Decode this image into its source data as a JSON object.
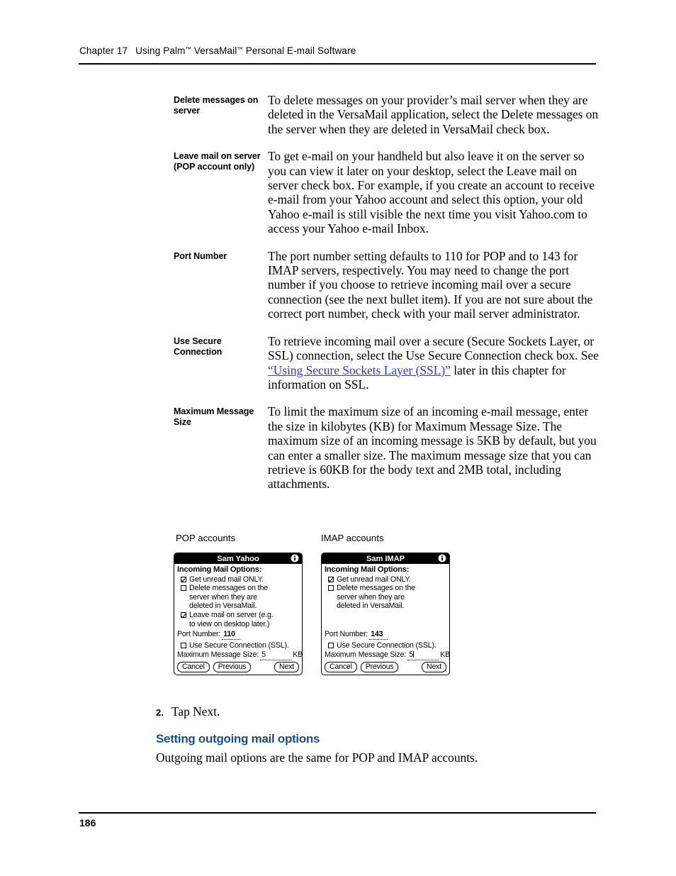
{
  "header": {
    "chapter": "Chapter 17",
    "title_part1": "Using Palm",
    "tm1": "™",
    "title_part2": " VersaMail",
    "tm2": "™",
    "title_part3": " Personal E-mail Software"
  },
  "definitions": [
    {
      "term": "Delete messages on server",
      "description": "To delete messages on your provider’s mail server when they are deleted in the VersaMail application, select the Delete messages on the server when they are deleted in VersaMail check box."
    },
    {
      "term": "Leave mail on server (POP account only)",
      "description": "To get e-mail on your handheld but also leave it on the server so you can view it later on your desktop, select the Leave mail on server check box. For example, if you create an account to receive e-mail from your Yahoo account and select this option, your old Yahoo e-mail is still visible the next time you visit Yahoo.com to access your Yahoo e-mail Inbox."
    },
    {
      "term": "Port Number",
      "description": "The port number setting defaults to 110 for POP and to 143 for IMAP servers, respectively. You may need to change the port number if you choose to retrieve incoming mail over a secure connection (see the next bullet item). If you are not sure about the correct port number, check with your mail server administrator."
    },
    {
      "term": "Use Secure Connection",
      "desc_before": "To retrieve incoming mail over a secure (Secure Sockets Layer, or SSL) connection, select the Use Secure Connection check box. See ",
      "link_text": "“Using Secure Sockets Layer (SSL)”",
      "desc_after": " later in this chapter for information on SSL."
    },
    {
      "term": "Maximum Message Size",
      "description": "To limit the maximum size of an incoming e-mail message, enter the size in kilobytes (KB) for Maximum Message Size. The maximum size of an incoming message is 5KB by default, but you can enter a smaller size. The maximum message size that you can retrieve is 60KB for the body text and 2MB total, including attachments."
    }
  ],
  "figures": {
    "pop_caption": "POP accounts",
    "imap_caption": "IMAP accounts",
    "pop_panel": {
      "title": "Sam Yahoo",
      "info_icon": "info-icon",
      "heading": "Incoming Mail Options:",
      "checkbox_1_label": "Get unread mail ONLY.",
      "checkbox_1_checked": true,
      "checkbox_2_label_line1": "Delete messages on the",
      "checkbox_2_label_line2": "server when they are",
      "checkbox_2_label_line3": "deleted in VersaMail.",
      "checkbox_2_checked": false,
      "checkbox_3_label_line1": "Leave mail on server (e.g.",
      "checkbox_3_label_line2": "to view on desktop later.)",
      "checkbox_3_checked": true,
      "port_label": "Port Number:",
      "port_value": "110",
      "ssl_label": "Use Secure Connection (SSL).",
      "ssl_checked": false,
      "maxsize_label": "Maximum Message Size:",
      "maxsize_value": "5",
      "maxsize_unit": "KB.",
      "btn_cancel": "Cancel",
      "btn_previous": "Previous",
      "btn_next": "Next"
    },
    "imap_panel": {
      "title": "Sam IMAP",
      "info_icon": "info-icon",
      "heading": "Incoming Mail Options:",
      "checkbox_1_label": "Get unread mail ONLY.",
      "checkbox_1_checked": true,
      "checkbox_2_label_line1": "Delete messages on the",
      "checkbox_2_label_line2": "server when they are",
      "checkbox_2_label_line3": "deleted in VersaMail.",
      "checkbox_2_checked": false,
      "port_label": "Port Number:",
      "port_value": "143",
      "ssl_label": "Use Secure Connection (SSL).",
      "ssl_checked": false,
      "maxsize_label": "Maximum Message Size:",
      "maxsize_value": "5",
      "maxsize_unit": "KB.",
      "btn_cancel": "Cancel",
      "btn_previous": "Previous",
      "btn_next": "Next"
    }
  },
  "step": {
    "number": "2.",
    "text": "Tap Next."
  },
  "section": {
    "heading": "Setting outgoing mail options",
    "paragraph": "Outgoing mail options are the same for POP and IMAP accounts."
  },
  "footer": {
    "page_number": "186"
  },
  "colors": {
    "link": "#3333cc",
    "heading": "#1f4e79",
    "titlebar": "#000000"
  }
}
